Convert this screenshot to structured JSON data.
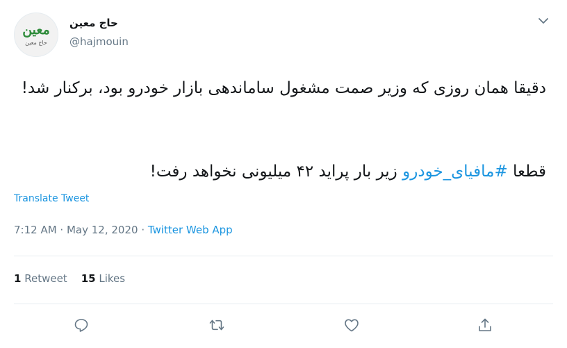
{
  "user": {
    "display_name": "حاج معین",
    "handle": "@hajmouin",
    "avatar_logo_text": "معین",
    "avatar_caption": "حاج معین"
  },
  "tweet": {
    "paragraph1": "دقیقا همان روزی که وزیر صمت مشغول ساماندهی بازار خودرو بود، برکنار شد!",
    "paragraph2_prefix": "قطعا ",
    "hashtag": "#مافیای_خودرو",
    "paragraph2_suffix": " زیر بار پراید ۴۲ میلیونی نخواهد رفت!"
  },
  "translate_label": "Translate Tweet",
  "meta": {
    "time": "7:12 AM",
    "separator1": " · ",
    "date": "May 12, 2020",
    "separator2": " · ",
    "source": "Twitter Web App"
  },
  "stats": {
    "retweets_count": "1",
    "retweets_label": "Retweet",
    "likes_count": "15",
    "likes_label": "Likes"
  },
  "icons": {
    "menu": "chevron-down-icon",
    "reply": "reply-icon",
    "retweet": "retweet-icon",
    "like": "heart-icon",
    "share": "share-icon"
  },
  "colors": {
    "link": "#1b95e0",
    "secondary_text": "#657786",
    "primary_text": "#14171a",
    "divider": "#e6ecf0",
    "avatar_logo": "#2e8b3a"
  }
}
